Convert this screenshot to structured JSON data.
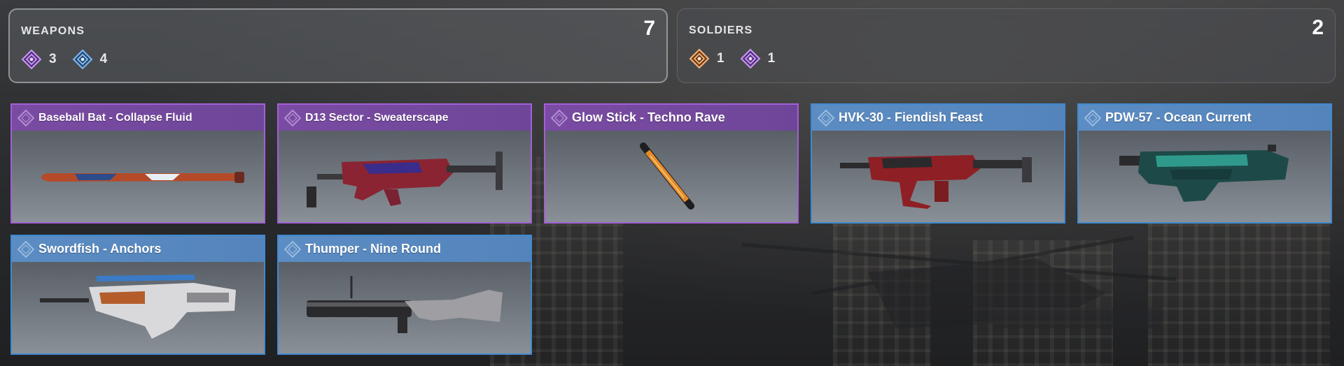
{
  "summary": {
    "weapons": {
      "title": "WEAPONS",
      "total": "7",
      "rarities": [
        {
          "icon": "epic-rarity-icon",
          "color": "#b07fe6",
          "count": "3"
        },
        {
          "icon": "rare-rarity-icon",
          "color": "#5da6e8",
          "count": "4"
        }
      ]
    },
    "soldiers": {
      "title": "SOLDIERS",
      "total": "2",
      "rarities": [
        {
          "icon": "legendary-rarity-icon",
          "color": "#f0a15a",
          "count": "1"
        },
        {
          "icon": "epic-rarity-icon",
          "color": "#b07fe6",
          "count": "1"
        }
      ]
    }
  },
  "items": [
    {
      "name": "Baseball Bat - Collapse Fluid",
      "rarity": "epic"
    },
    {
      "name": "D13 Sector - Sweaterscape",
      "rarity": "epic"
    },
    {
      "name": "Glow Stick - Techno Rave",
      "rarity": "epic"
    },
    {
      "name": "HVK-30 - Fiendish Feast",
      "rarity": "rare"
    },
    {
      "name": "PDW-57 - Ocean Current",
      "rarity": "rare"
    },
    {
      "name": "Swordfish - Anchors",
      "rarity": "rare"
    },
    {
      "name": "Thumper - Nine Round",
      "rarity": "rare"
    }
  ],
  "colors": {
    "epic": "#a35fd6",
    "rare": "#3f8ad1",
    "legendary": "#f0a15a"
  }
}
